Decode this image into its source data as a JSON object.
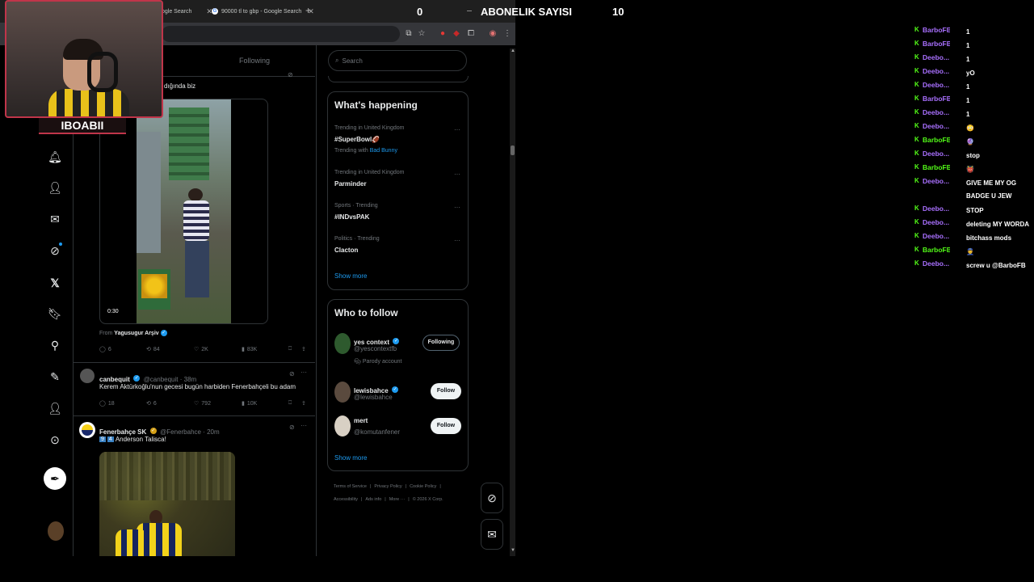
{
  "browser": {
    "tabs": [
      {
        "label": "ogle Search"
      },
      {
        "label": "90000 tl to gbp - Google Search"
      }
    ]
  },
  "overlay": {
    "counter_left": "0",
    "subscriber_label": "ABONELIK SAYISI",
    "subscriber_count": "10"
  },
  "webcam": {
    "label": "IBOABII"
  },
  "feed": {
    "header_tab": "Following",
    "top_post": {
      "partial_text": "dığında biz",
      "video_duration": "0:30",
      "source_prefix": "From",
      "source_name": "Yagusugur Arşiv",
      "replies": "6",
      "reposts": "84",
      "likes": "2K",
      "views": "83K"
    },
    "post2": {
      "name": "canbequit",
      "handle": "@canbequit · 38m",
      "text": "Kerem Aktürkoğlu'nun gecesi bugün harbiden Fenerbahçeli bu adam",
      "replies": "18",
      "reposts": "6",
      "likes": "792",
      "views": "10K"
    },
    "post3": {
      "name": "Fenerbahçe SK",
      "handle": "@Fenerbahce · 20m",
      "text_badges": [
        "9",
        "4"
      ],
      "text": "Anderson Talisca!"
    }
  },
  "sidebar": {
    "search_placeholder": "Search",
    "happening": {
      "title": "What's happening",
      "trends": [
        {
          "meta": "Trending in United Kingdom",
          "title": "#SuperBowl🏈",
          "sub_prefix": "Trending with",
          "sub_link": "Bad Bunny"
        },
        {
          "meta": "Trending in United Kingdom",
          "title": "Parminder"
        },
        {
          "meta": "Sports · Trending",
          "title": "#INDvsPAK"
        },
        {
          "meta": "Politics · Trending",
          "title": "Clacton"
        }
      ],
      "show_more": "Show more"
    },
    "who_to_follow": {
      "title": "Who to follow",
      "accounts": [
        {
          "name": "yes context",
          "handle": "@yescontextfb",
          "extra": "Parody account",
          "button": "Following"
        },
        {
          "name": "lewisbahce",
          "handle": "@lewisbahce",
          "button": "Follow"
        },
        {
          "name": "mert",
          "handle": "@komutanfener",
          "button": "Follow"
        }
      ],
      "show_more": "Show more"
    },
    "footer": {
      "line1": [
        "Terms of Service",
        "Privacy Policy",
        "Cookie Policy"
      ],
      "line2": [
        "Accessibility",
        "Ads info",
        "More ···",
        "© 2026 X Corp."
      ]
    }
  },
  "chat": {
    "messages": [
      {
        "user": "BarboFB",
        "color": "#a970ff",
        "msg": "1"
      },
      {
        "user": "BarboFB",
        "color": "#a970ff",
        "msg": "1"
      },
      {
        "user": "Deebo...",
        "color": "#a970ff",
        "msg": "1"
      },
      {
        "user": "Deebo...",
        "color": "#a970ff",
        "msg": "yO"
      },
      {
        "user": "Deebo...",
        "color": "#a970ff",
        "msg": "1"
      },
      {
        "user": "BarboFB",
        "color": "#a970ff",
        "msg": "1"
      },
      {
        "user": "Deebo...",
        "color": "#a970ff",
        "msg": "1"
      },
      {
        "user": "Deebo...",
        "color": "#a970ff",
        "msg": "😳"
      },
      {
        "user": "BarboFB",
        "color": "#53fc18",
        "msg": "🔮"
      },
      {
        "user": "Deebo...",
        "color": "#a970ff",
        "msg": "stop"
      },
      {
        "user": "BarboFB",
        "color": "#53fc18",
        "msg": "👹"
      },
      {
        "user": "Deebo...",
        "color": "#a970ff",
        "msg": "GIVE ME MY OG BADGE U JEW"
      },
      {
        "user": "Deebo...",
        "color": "#a970ff",
        "msg": "STOP"
      },
      {
        "user": "Deebo...",
        "color": "#a970ff",
        "msg": "deleting MY WORDA"
      },
      {
        "user": "Deebo...",
        "color": "#a970ff",
        "msg": "bitchass mods"
      },
      {
        "user": "BarboFB",
        "color": "#53fc18",
        "msg": "👮"
      },
      {
        "user": "Deebo...",
        "color": "#a970ff",
        "msg": "screw u @BarboFB"
      }
    ]
  },
  "colors": {
    "accent": "#1d9bf0",
    "border": "#2f3336",
    "webcam_frame": "#c0354a",
    "kick_green": "#53fc18"
  }
}
